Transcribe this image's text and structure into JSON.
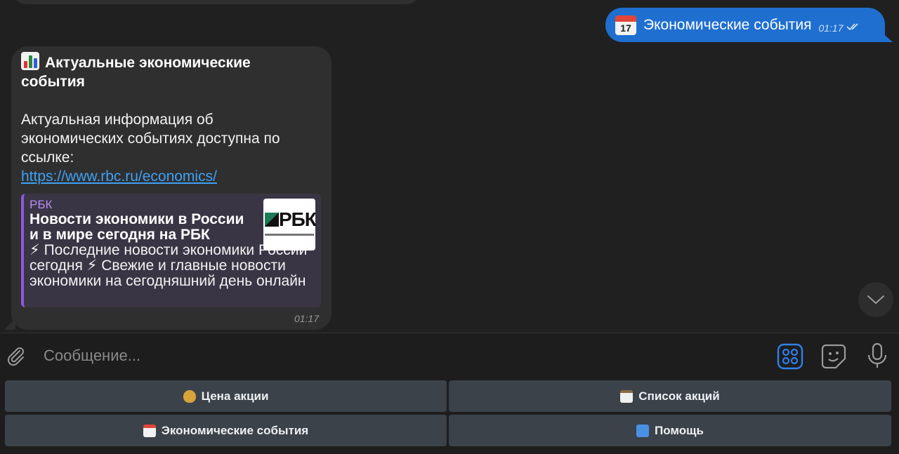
{
  "outgoing": {
    "emoji_day": "17",
    "text": "Экономические события",
    "time": "01:17"
  },
  "incoming": {
    "title": "Актуальные экономические события",
    "body": "Актуальная информация об экономических событиях доступна по ссылке:",
    "link": "https://www.rbc.ru/economics/",
    "preview": {
      "site": "РБК",
      "title": "Новости экономики в России и в мире сегодня на РБК",
      "description": "⚡ Последние новости экономики России сегодня ⚡ Свежие и главные новости экономики на сегодняшний день онлайн",
      "thumb_text": "РБК"
    },
    "time": "01:17"
  },
  "composer": {
    "placeholder": "Сообщение..."
  },
  "keyboard": {
    "price_label": "Цена акции",
    "list_label": "Список акций",
    "events_label": "Экономические события",
    "help_label": "Помощь"
  },
  "colors": {
    "outgoing_bubble": "#1f6fd0",
    "incoming_bubble": "#2f2f2f",
    "link": "#3ea0f5",
    "preview_accent": "#8e59e0",
    "keyboard_button": "#3b424a"
  },
  "icons": [
    "calendar-icon",
    "bar-chart-icon",
    "double-check-icon",
    "chevron-down-icon",
    "paperclip-icon",
    "bot-keyboard-icon",
    "sticker-icon",
    "microphone-icon",
    "money-bag-icon",
    "clipboard-icon",
    "info-icon"
  ]
}
